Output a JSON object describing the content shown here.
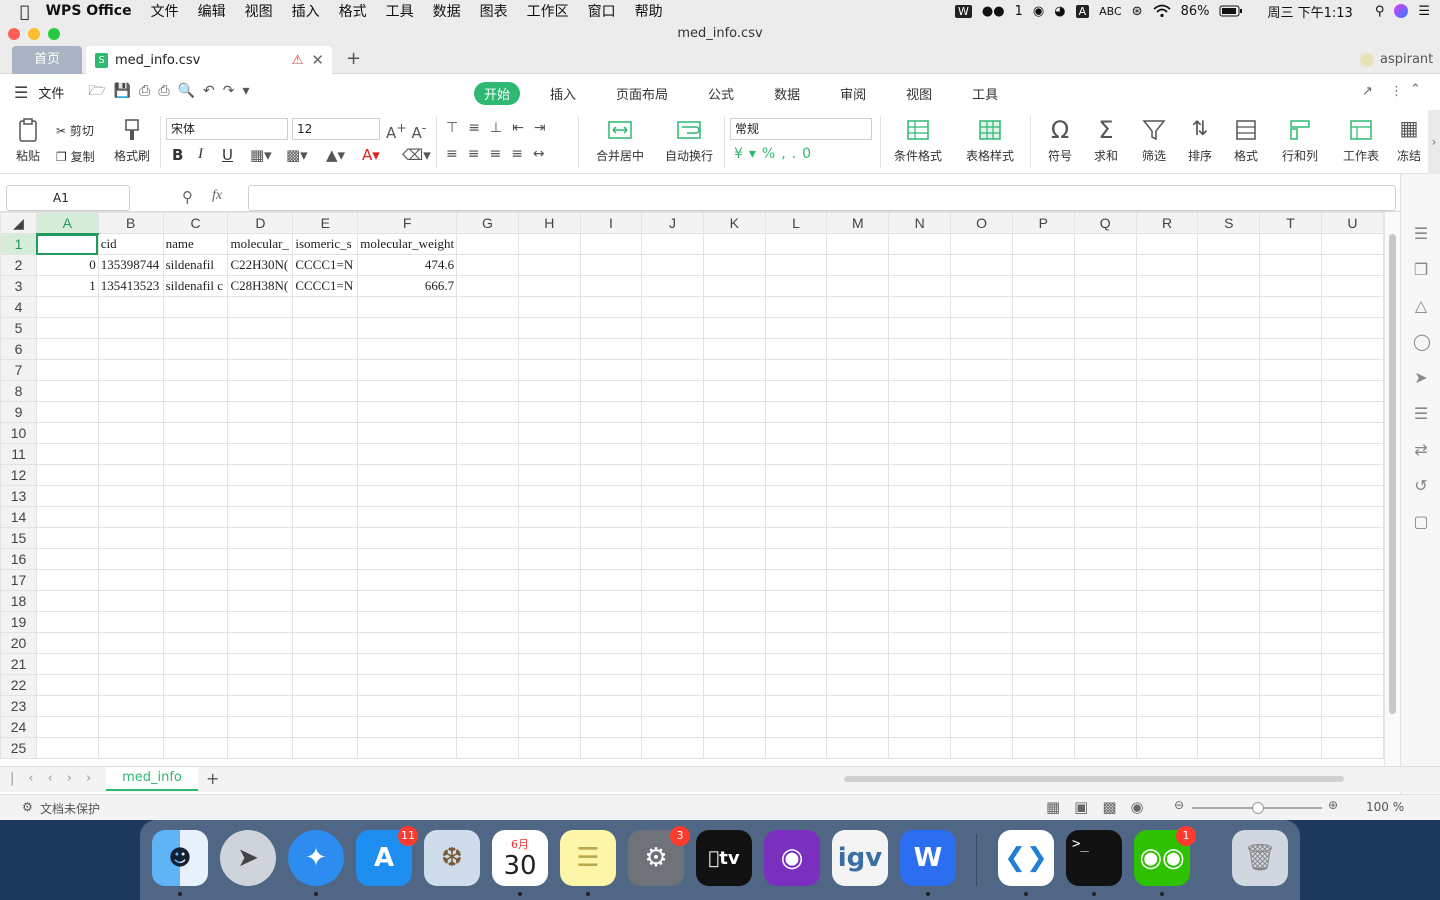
{
  "menubar": {
    "app": "WPS Office",
    "items": [
      "文件",
      "编辑",
      "视图",
      "插入",
      "格式",
      "工具",
      "数据",
      "图表",
      "工作区",
      "窗口",
      "帮助"
    ],
    "status": {
      "wechat_count": "1",
      "input_method": "ABC",
      "battery": "86%",
      "datetime": "周三 下午1:13"
    }
  },
  "window": {
    "title": "med_info.csv"
  },
  "tabs": {
    "home": "首页",
    "doc": "med_info.csv",
    "add": "+",
    "user": "aspirant"
  },
  "ribbon_head": {
    "file_menu": "文件",
    "tabs": [
      "开始",
      "插入",
      "页面布局",
      "公式",
      "数据",
      "审阅",
      "视图",
      "工具"
    ],
    "active_tab": "开始"
  },
  "ribbon": {
    "paste": "粘贴",
    "cut": "剪切",
    "copy": "复制",
    "format_painter": "格式刷",
    "font_name": "宋体",
    "font_size": "12",
    "bold": "B",
    "italic": "I",
    "underline": "U",
    "merge_center": "合并居中",
    "wrap_text": "自动换行",
    "number_format": "常规",
    "cond_format": "条件格式",
    "table_style": "表格样式",
    "symbol": "符号",
    "sum": "求和",
    "filter": "筛选",
    "sort": "排序",
    "format": "格式",
    "rows_cols": "行和列",
    "worksheet": "工作表",
    "freeze": "冻结"
  },
  "formula_bar": {
    "name_box": "A1",
    "fx": "fx",
    "content": ""
  },
  "sheet": {
    "columns": [
      "A",
      "B",
      "C",
      "D",
      "E",
      "F",
      "G",
      "H",
      "I",
      "J",
      "K",
      "L",
      "M",
      "N",
      "O",
      "P",
      "Q",
      "R",
      "S",
      "T",
      "U"
    ],
    "rows": [
      [
        "",
        "cid",
        "name",
        "molecular_",
        "isomeric_s",
        "molecular_weight"
      ],
      [
        "0",
        "135398744",
        "sildenafil",
        "C22H30N(",
        "CCCC1=N",
        "474.6"
      ],
      [
        "1",
        "135413523",
        "sildenafil c",
        "C28H38N(",
        "CCCC1=N",
        "666.7"
      ]
    ],
    "row_numbers": [
      "1",
      "2",
      "3",
      "4",
      "5",
      "6",
      "7",
      "8",
      "9",
      "10",
      "11",
      "12",
      "13",
      "14",
      "15",
      "16",
      "17",
      "18",
      "19",
      "20",
      "21",
      "22",
      "23",
      "24",
      "25"
    ]
  },
  "sheet_tabs": {
    "active": "med_info",
    "add": "+"
  },
  "status": {
    "protection": "文档未保护",
    "zoom": "100 %"
  },
  "dock": {
    "badges": {
      "appstore": "11",
      "sysprefs": "3",
      "wechat": "1"
    },
    "calendar_month": "6月",
    "calendar_day": "30",
    "tv_label": "tv",
    "igv_label": "igv"
  },
  "colors": {
    "accent": "#2eb872",
    "selection": "#1e9b5d",
    "header_active": "#d7ebd9"
  }
}
